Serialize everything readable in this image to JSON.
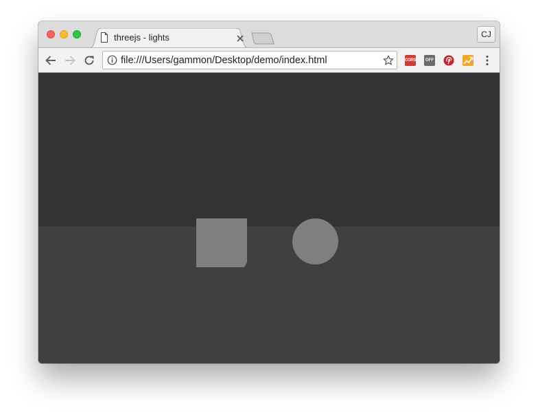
{
  "tab": {
    "title": "threejs - lights"
  },
  "omnibox": {
    "url": "file:///Users/gammon/Desktop/demo/index.html"
  },
  "profile": {
    "initials": "CJ"
  },
  "extensions": {
    "cors_label": "CORS",
    "off_label": "OFF"
  },
  "colors": {
    "scene_background": "#333333",
    "floor": "#404040",
    "objects": "#7f7f7f",
    "cors_badge": "#d63a2f",
    "pinterest": "#cb2027",
    "analytics": "#f5a623"
  }
}
